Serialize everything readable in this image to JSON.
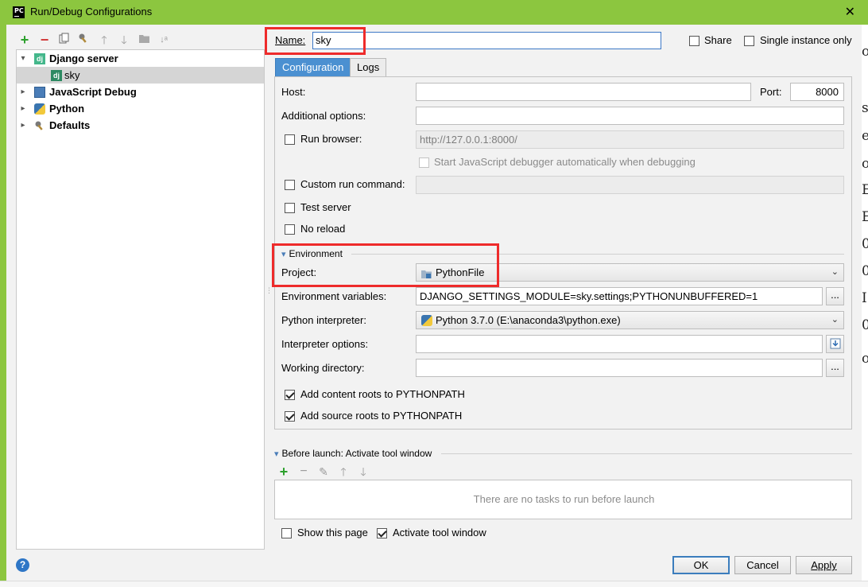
{
  "window": {
    "title": "Run/Debug Configurations",
    "app_icon_text": "PC"
  },
  "tree": {
    "items": [
      {
        "label": "Django server",
        "bold": true,
        "icon": "django-icon"
      },
      {
        "label": "sky",
        "bold": false,
        "icon": "django-icon",
        "selected": true
      },
      {
        "label": "JavaScript Debug",
        "bold": true,
        "icon": "javascript-debug-icon"
      },
      {
        "label": "Python",
        "bold": true,
        "icon": "python-icon"
      },
      {
        "label": "Defaults",
        "bold": true,
        "icon": "wrench-icon"
      }
    ],
    "dj_text": "dj"
  },
  "name": {
    "label": "Name:",
    "value": "sky"
  },
  "header_options": {
    "share": "Share",
    "single_instance": "Single instance only"
  },
  "tabs": [
    "Configuration",
    "Logs"
  ],
  "config": {
    "host_label": "Host:",
    "host_value": "",
    "port_label": "Port:",
    "port_value": "8000",
    "additional_options_label": "Additional options:",
    "run_browser_label": "Run browser:",
    "run_browser_url": "http://127.0.0.1:8000/",
    "js_debugger_label": "Start JavaScript debugger automatically when debugging",
    "custom_run_label": "Custom run command:",
    "test_server_label": "Test server",
    "no_reload_label": "No reload"
  },
  "environment": {
    "section_title": "Environment",
    "project_label": "Project:",
    "project_value": "PythonFile",
    "env_vars_label": "Environment variables:",
    "env_vars_value": "DJANGO_SETTINGS_MODULE=sky.settings;PYTHONUNBUFFERED=1",
    "interpreter_label": "Python interpreter:",
    "interpreter_value": "Python 3.7.0 (E:\\anaconda3\\python.exe)",
    "interpreter_options_label": "Interpreter options:",
    "working_dir_label": "Working directory:",
    "content_roots_label": "Add content roots to PYTHONPATH",
    "source_roots_label": "Add source roots to PYTHONPATH",
    "ellipsis": "..."
  },
  "before_launch": {
    "title": "Before launch: Activate tool window",
    "empty_message": "There are no tasks to run before launch",
    "show_page_label": "Show this page",
    "activate_window_label": "Activate tool window"
  },
  "footer": {
    "ok": "OK",
    "cancel": "Cancel",
    "apply": "Apply",
    "help": "?"
  },
  "background_chars": [
    "o",
    "s",
    "e",
    "o",
    "E",
    "E",
    "0",
    "0",
    "I",
    "0",
    "o"
  ],
  "colors": {
    "title_bar": "#8cc63f",
    "accent": "#4b90d1",
    "highlight_box": "#ee2b2b",
    "add_green": "#2ca02c",
    "remove_red": "#d13b3b"
  }
}
